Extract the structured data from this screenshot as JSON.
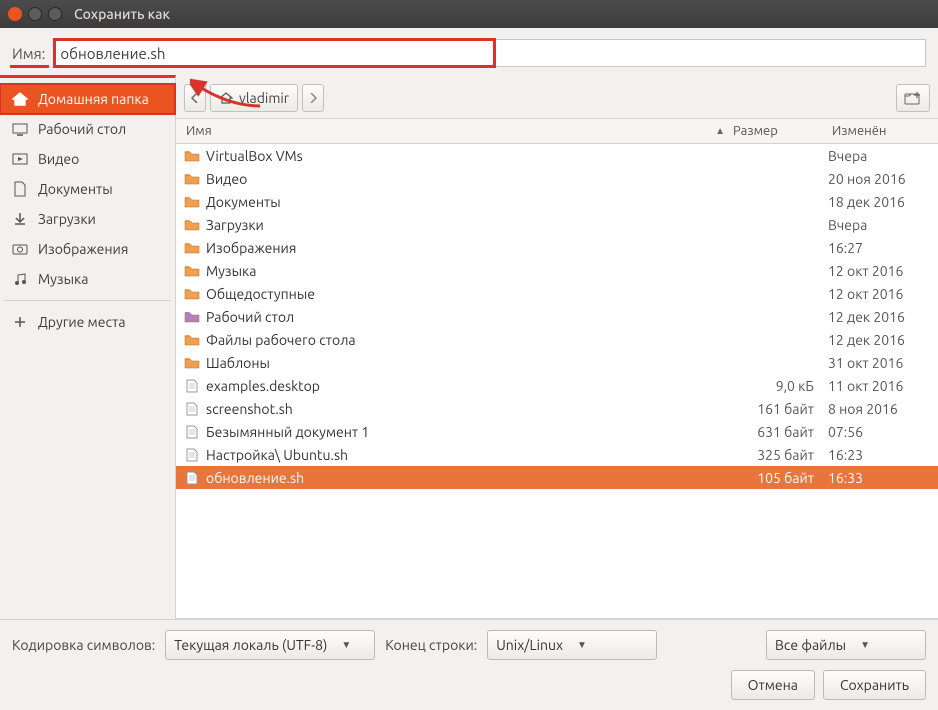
{
  "window": {
    "title": "Сохранить как"
  },
  "name_row": {
    "label": "Имя:",
    "value": "обновление.sh"
  },
  "sidebar": {
    "items": [
      {
        "label": "Домашняя папка",
        "icon": "home",
        "active": true
      },
      {
        "label": "Рабочий стол",
        "icon": "desktop",
        "active": false
      },
      {
        "label": "Видео",
        "icon": "video",
        "active": false
      },
      {
        "label": "Документы",
        "icon": "document",
        "active": false
      },
      {
        "label": "Загрузки",
        "icon": "download",
        "active": false
      },
      {
        "label": "Изображения",
        "icon": "camera",
        "active": false
      },
      {
        "label": "Музыка",
        "icon": "music",
        "active": false
      }
    ],
    "other": {
      "label": "Другие места",
      "icon": "plus"
    }
  },
  "path": {
    "segments": [
      "vladimir"
    ]
  },
  "columns": {
    "name": "Имя",
    "size": "Размер",
    "modified": "Изменён"
  },
  "files": [
    {
      "name": "VirtualBox VMs",
      "icon": "folder",
      "size": "",
      "modified": "Вчера",
      "selected": false
    },
    {
      "name": "Видео",
      "icon": "folder-video",
      "size": "",
      "modified": "20 ноя 2016",
      "selected": false
    },
    {
      "name": "Документы",
      "icon": "folder-doc",
      "size": "",
      "modified": "18 дек 2016",
      "selected": false
    },
    {
      "name": "Загрузки",
      "icon": "folder-down",
      "size": "",
      "modified": "Вчера",
      "selected": false
    },
    {
      "name": "Изображения",
      "icon": "folder-pic",
      "size": "",
      "modified": "16:27",
      "selected": false
    },
    {
      "name": "Музыка",
      "icon": "folder-music",
      "size": "",
      "modified": "12 окт 2016",
      "selected": false
    },
    {
      "name": "Общедоступные",
      "icon": "folder-share",
      "size": "",
      "modified": "12 окт 2016",
      "selected": false
    },
    {
      "name": "Рабочий стол",
      "icon": "folder-desk",
      "size": "",
      "modified": "12 дек 2016",
      "selected": false
    },
    {
      "name": "Файлы рабочего стола",
      "icon": "folder",
      "size": "",
      "modified": "12 дек 2016",
      "selected": false
    },
    {
      "name": "Шаблоны",
      "icon": "folder",
      "size": "",
      "modified": "31 окт 2016",
      "selected": false
    },
    {
      "name": "examples.desktop",
      "icon": "file",
      "size": "9,0 кБ",
      "modified": "11 окт 2016",
      "selected": false
    },
    {
      "name": "screenshot.sh",
      "icon": "file",
      "size": "161 байт",
      "modified": "8 ноя 2016",
      "selected": false
    },
    {
      "name": "Безымянный документ 1",
      "icon": "file",
      "size": "631 байт",
      "modified": "07:56",
      "selected": false
    },
    {
      "name": "Настройка\\ Ubuntu.sh",
      "icon": "file",
      "size": "325 байт",
      "modified": "16:23",
      "selected": false
    },
    {
      "name": "обновление.sh",
      "icon": "file",
      "size": "105 байт",
      "modified": "16:33",
      "selected": true
    }
  ],
  "bottom": {
    "encoding_label": "Кодировка символов:",
    "encoding_value": "Текущая локаль (UTF-8)",
    "eol_label": "Конец строки:",
    "eol_value": "Unix/Linux",
    "filter_value": "Все файлы",
    "cancel": "Отмена",
    "save": "Сохранить"
  }
}
